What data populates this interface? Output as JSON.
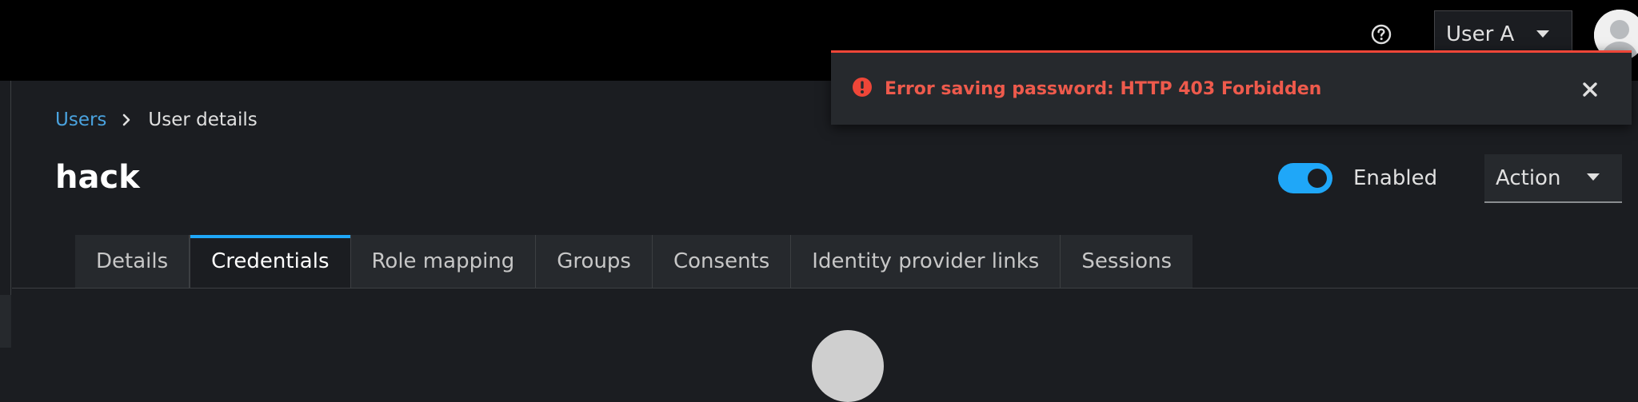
{
  "masthead": {
    "user_menu": {
      "label": "User A"
    }
  },
  "breadcrumb": {
    "items": [
      {
        "label": "Users"
      },
      {
        "label": "User details"
      }
    ]
  },
  "page": {
    "title": "hack",
    "enabled_switch": {
      "label": "Enabled",
      "on": true
    },
    "action_dropdown": {
      "label": "Action"
    }
  },
  "tabs": [
    {
      "label": "Details",
      "active": false
    },
    {
      "label": "Credentials",
      "active": true
    },
    {
      "label": "Role mapping",
      "active": false
    },
    {
      "label": "Groups",
      "active": false
    },
    {
      "label": "Consents",
      "active": false
    },
    {
      "label": "Identity provider links",
      "active": false
    },
    {
      "label": "Sessions",
      "active": false
    }
  ],
  "alert": {
    "severity": "danger",
    "title": "Error saving password: HTTP 403 Forbidden"
  },
  "icons": {
    "help": "question-circle-icon",
    "caret": "caret-down-icon",
    "avatar": "user-avatar-icon",
    "breadcrumb_sep": "chevron-right-icon",
    "alert": "exclamation-circle-icon",
    "close": "close-icon"
  },
  "colors": {
    "masthead_bg": "#000000",
    "page_bg": "#1b1d21",
    "link": "#4aa3df",
    "accent": "#1fa7f8",
    "danger": "#ee4638",
    "danger_text": "#ee5a4c"
  }
}
